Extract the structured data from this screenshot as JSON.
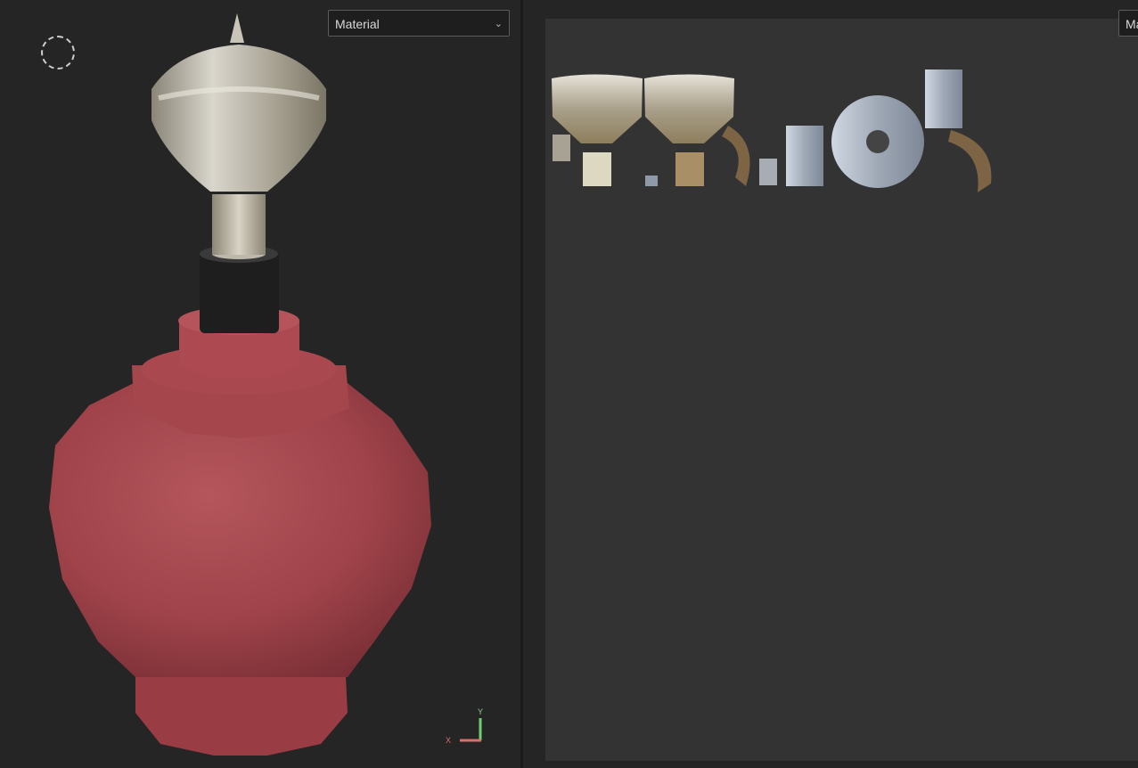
{
  "viewport_3d": {
    "shading_mode": {
      "selected": "Material"
    },
    "axis_gizmo": {
      "x_label": "X",
      "y_label": "Y"
    },
    "icons": {
      "camera": "camera-orbit-icon",
      "dropdown": "chevron-down-icon"
    }
  },
  "viewport_2d": {
    "shading_mode": {
      "selected": "Ma"
    }
  },
  "colors": {
    "background": "#252525",
    "uv_canvas": "#333333",
    "vase": "#a4444b",
    "metal": "#b9b3a3",
    "axis_x": "#e06d6d",
    "axis_y": "#6ed06e"
  }
}
